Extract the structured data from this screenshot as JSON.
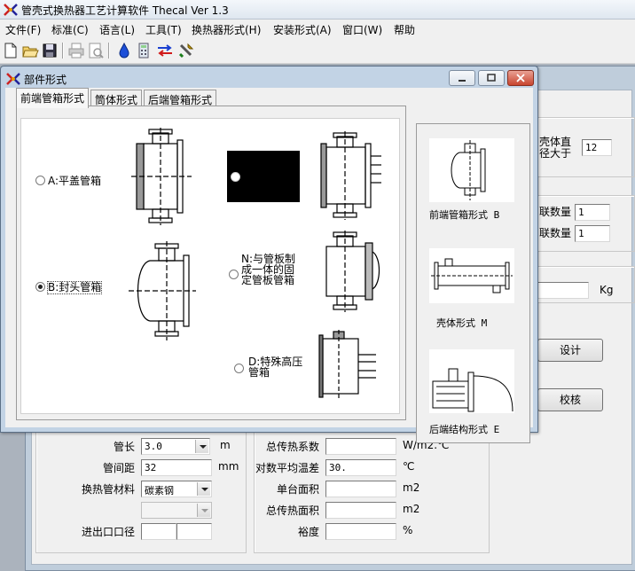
{
  "app": {
    "title": "管壳式换热器工艺计算软件 Thecal Ver 1.3"
  },
  "menu": [
    "文件(F)",
    "标准(C)",
    "语言(L)",
    "工具(T)",
    "换热器形式(H)",
    "安装形式(A)",
    "窗口(W)",
    "帮助"
  ],
  "toolbar": [
    "new-icon",
    "open-icon",
    "save-icon",
    "print-icon",
    "print-preview-icon",
    "water-drop-icon",
    "calculator-icon",
    "exchange-arrows-icon",
    "tools-icon"
  ],
  "dialog": {
    "title": "部件形式",
    "tabs": [
      "前端管箱形式",
      "筒体形式",
      "后端管箱形式"
    ],
    "options": {
      "a": "A:平盖管箱",
      "b": "B:封头管箱",
      "n": "N:与管板制成一体的固定管板管箱",
      "d": "D:特殊高压管箱"
    },
    "selected": "B",
    "preview": {
      "front": "前端管箱形式 B",
      "shell": "壳体形式 M",
      "rear": "后端结构形式 E"
    }
  },
  "back_panel": {
    "shell_label": "壳体直径大于",
    "shell_value": "12",
    "count1_label": "联数量",
    "count1_value": "1",
    "count2_label": "联数量",
    "count2_value": "1",
    "kg_unit": "Kg",
    "design_button": "设计",
    "check_button": "校核",
    "tube_length_label": "管长",
    "tube_length_value": "3.0",
    "tube_length_unit": "m",
    "tube_pitch_label": "管间距",
    "tube_pitch_value": "32",
    "tube_pitch_unit": "mm",
    "tube_material_label": "换热管材料",
    "tube_material_value": "碳素钢",
    "inlet_label": "进出口口径",
    "htc_label": "总传热系数",
    "htc_unit": "W/m2.℃",
    "lmtd_label": "对数平均温差",
    "lmtd_value": "30.",
    "lmtd_unit": "℃",
    "unit_area_label": "单台面积",
    "unit_area_unit": "m2",
    "total_area_label": "总传热面积",
    "total_area_unit": "m2",
    "margin_label": "裕度",
    "margin_unit": "%"
  }
}
